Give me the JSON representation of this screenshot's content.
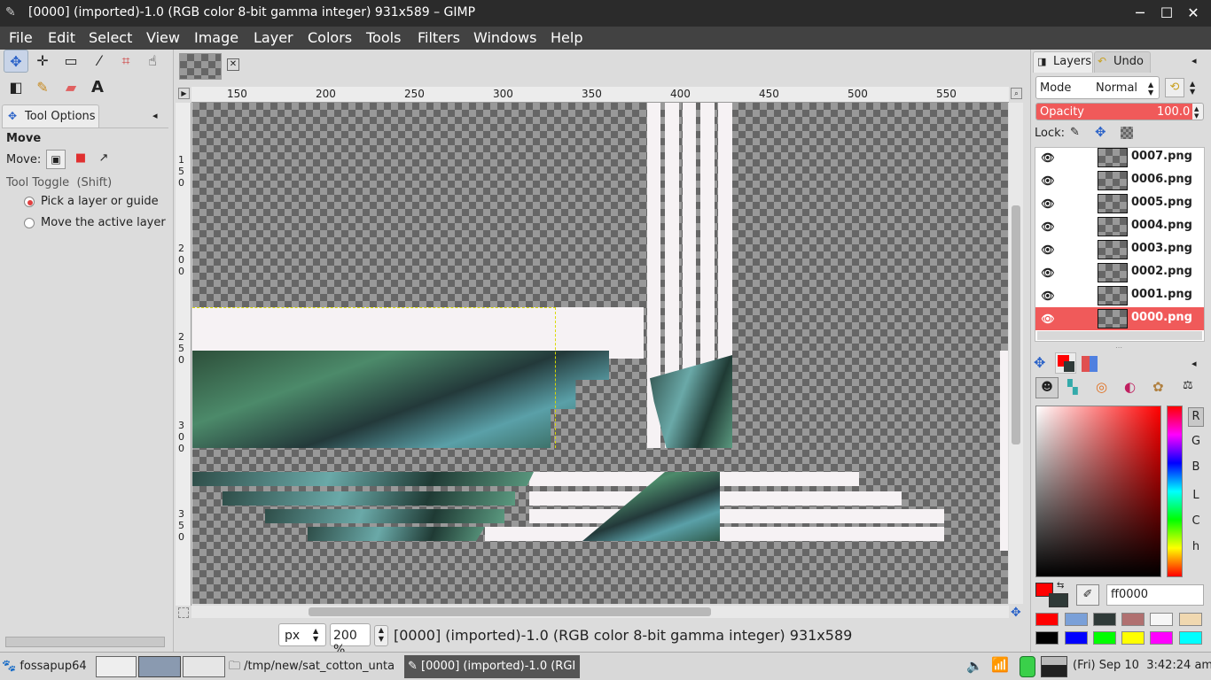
{
  "window": {
    "title": "[0000] (imported)-1.0 (RGB color 8-bit gamma integer) 931x589 – GIMP",
    "app_icon": "gimp-wilber-icon",
    "controls": [
      "minimize-icon",
      "maximize-icon",
      "close-icon"
    ]
  },
  "menu": [
    {
      "label": "File"
    },
    {
      "label": "Edit"
    },
    {
      "label": "Select"
    },
    {
      "label": "View"
    },
    {
      "label": "Image"
    },
    {
      "label": "Layer"
    },
    {
      "label": "Colors"
    },
    {
      "label": "Tools"
    },
    {
      "label": "Filters"
    },
    {
      "label": "Windows"
    },
    {
      "label": "Help"
    }
  ],
  "toolbox": {
    "row1": [
      "move-tool-icon",
      "align-tool-icon",
      "rect-select-icon",
      "fuzzy-select-icon",
      "crop-tool-icon",
      "warp-tool-icon"
    ],
    "row2": [
      "gradient-tool-icon",
      "pencil-tool-icon",
      "eraser-tool-icon",
      "text-tool-icon"
    ],
    "text_glyph": "A"
  },
  "tool_options": {
    "tab_label": "Tool Options",
    "title": "Move",
    "move_label": "Move:",
    "toggle_label": "Tool Toggle  (Shift)",
    "option1": "Pick a layer or guide",
    "option2": "Move the active layer",
    "selected_option": 1
  },
  "ruler": {
    "h_labels": [
      "150",
      "200",
      "250",
      "300",
      "350",
      "400",
      "450",
      "500",
      "550"
    ],
    "v_labels": [
      "150",
      "200",
      "250",
      "300",
      "350"
    ]
  },
  "status": {
    "unit": "px",
    "zoom": "200 %",
    "info": "[0000] (imported)-1.0 (RGB color 8-bit gamma integer) 931x589"
  },
  "layers_panel": {
    "tab_layers": "Layers",
    "tab_undo": "Undo",
    "mode_label": "Mode",
    "mode_value": "Normal",
    "opacity_label": "Opacity",
    "opacity_value": "100.0",
    "lock_label": "Lock:",
    "layers": [
      {
        "name": "0007.png",
        "active": false
      },
      {
        "name": "0006.png",
        "active": false
      },
      {
        "name": "0005.png",
        "active": false
      },
      {
        "name": "0004.png",
        "active": false
      },
      {
        "name": "0003.png",
        "active": false
      },
      {
        "name": "0002.png",
        "active": false
      },
      {
        "name": "0001.png",
        "active": false
      },
      {
        "name": "0000.png",
        "active": true
      }
    ]
  },
  "colors_panel": {
    "channel_buttons": [
      "R",
      "G",
      "B",
      "L",
      "C",
      "h"
    ],
    "hex_value": "ff0000",
    "fg_color": "#ff0000",
    "bg_color": "#2f3a38",
    "history": [
      "#ff0000",
      "#7aa0d8",
      "#2f3a38",
      "#b07070",
      "#f6f6f6",
      "#f0d8b0",
      "#000000",
      "#0000ff",
      "#00ff00",
      "#ffff00",
      "#ff00ff",
      "#00ffff"
    ]
  },
  "taskbar": {
    "start_label": "fossapup64",
    "item1": "/tmp/new/sat_cotton_unta",
    "item2": "[0000] (imported)-1.0 (RGI",
    "clock": "(Fri) Sep 10  3:42:24 am"
  }
}
